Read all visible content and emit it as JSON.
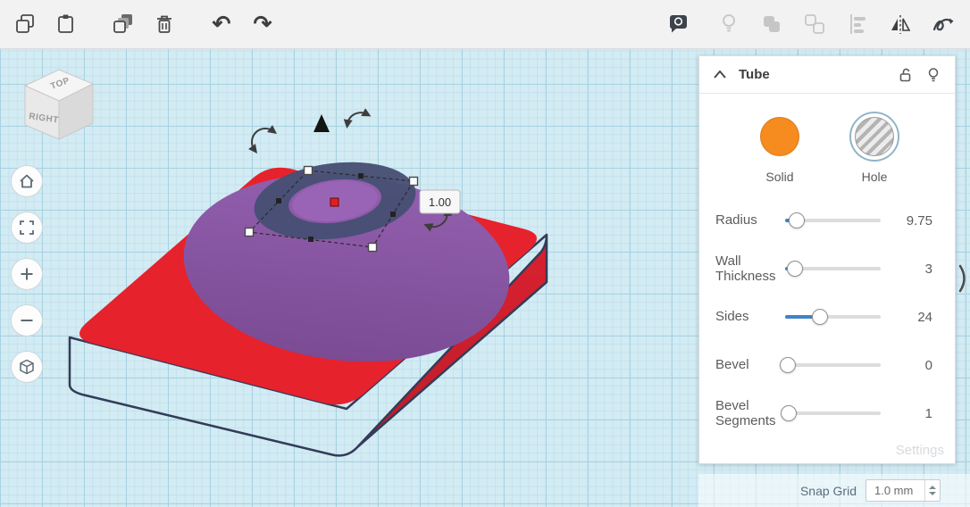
{
  "colors": {
    "accent_blue": "#3f83c6",
    "solid_orange": "#f68b1f",
    "box_red": "#e6222d",
    "ellipse_purple": "#8a56a5",
    "tube_navy": "#474f74",
    "grid_bg": "#d3ebf3"
  },
  "toolbar": {
    "icons_left": [
      "copy",
      "paste",
      "duplicate",
      "delete",
      "undo",
      "redo"
    ],
    "icons_right": [
      "notes",
      "show-all",
      "group",
      "ungroup",
      "align",
      "mirror",
      "scribble"
    ]
  },
  "view_cube": {
    "top_label": "TOP",
    "front_label": "RIGHT"
  },
  "scene": {
    "dimension_value": "1.00"
  },
  "inspector": {
    "title": "Tube",
    "swatches": {
      "solid_label": "Solid",
      "hole_label": "Hole",
      "selected": "Hole"
    },
    "sliders": [
      {
        "label": "Radius",
        "value": "9.75",
        "pos": 0.12
      },
      {
        "label": "Wall Thickness",
        "value": "3",
        "pos": 0.1
      },
      {
        "label": "Sides",
        "value": "24",
        "pos": 0.36
      },
      {
        "label": "Bevel",
        "value": "0",
        "pos": 0.03
      },
      {
        "label": "Bevel Segments",
        "value": "1",
        "pos": 0.04
      }
    ],
    "settings_label": "Settings"
  },
  "statusbar": {
    "snap_label": "Snap Grid",
    "snap_value": "1.0 mm"
  }
}
